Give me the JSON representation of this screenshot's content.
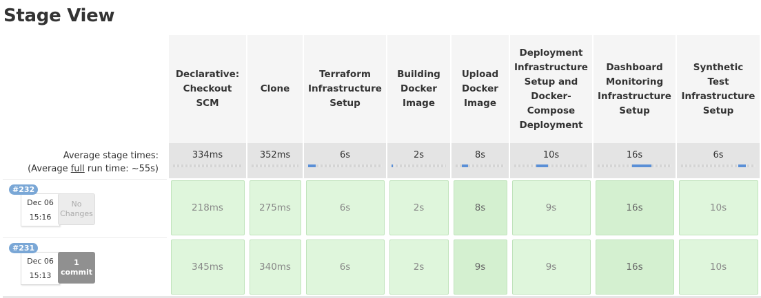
{
  "title": "Stage View",
  "average": {
    "label": "Average stage times:",
    "run_prefix": "(Average ",
    "run_full": "full",
    "run_suffix": " run time: ~55s)"
  },
  "stages": [
    {
      "name": "Declarative: Checkout SCM",
      "avg": "334ms",
      "bar_pct": [
        0,
        0
      ]
    },
    {
      "name": "Clone",
      "avg": "352ms",
      "bar_pct": [
        0,
        0
      ]
    },
    {
      "name": "Terraform Infrastructure Setup",
      "avg": "6s",
      "bar_pct": [
        0,
        10
      ]
    },
    {
      "name": "Building Docker Image",
      "avg": "2s",
      "bar_pct": [
        0,
        3
      ]
    },
    {
      "name": "Upload Docker Image",
      "avg": "8s",
      "bar_pct": [
        13,
        13
      ]
    },
    {
      "name": "Deployment Infrastructure Setup and Docker-Compose Deployment",
      "avg": "10s",
      "bar_pct": [
        30,
        16
      ]
    },
    {
      "name": "Dashboard Monitoring Infrastructure Setup",
      "avg": "16s",
      "bar_pct": [
        47,
        26
      ]
    },
    {
      "name": "Synthetic Test Infrastructure Setup",
      "avg": "6s",
      "bar_pct": [
        77,
        10
      ]
    }
  ],
  "builds": [
    {
      "number": "#232",
      "date": "Dec 06",
      "time": "15:16",
      "changes_line1": "No",
      "changes_line2": "Changes",
      "changes_type": "nochg",
      "times": [
        "218ms",
        "275ms",
        "6s",
        "2s",
        "8s",
        "9s",
        "16s",
        "10s"
      ]
    },
    {
      "number": "#231",
      "date": "Dec 06",
      "time": "15:13",
      "changes_line1": "1",
      "changes_line2": "commit",
      "changes_type": "commit",
      "times": [
        "345ms",
        "340ms",
        "6s",
        "2s",
        "9s",
        "9s",
        "16s",
        "10s"
      ]
    }
  ],
  "colors": {
    "success_bg": "#dff6dc",
    "success_dark_bg": "#d4f0d0",
    "header_bg": "#f5f5f5",
    "avg_bg": "#e4e4e4",
    "badge": "#7aa7d6",
    "bar_fill": "#5a8fd6"
  }
}
